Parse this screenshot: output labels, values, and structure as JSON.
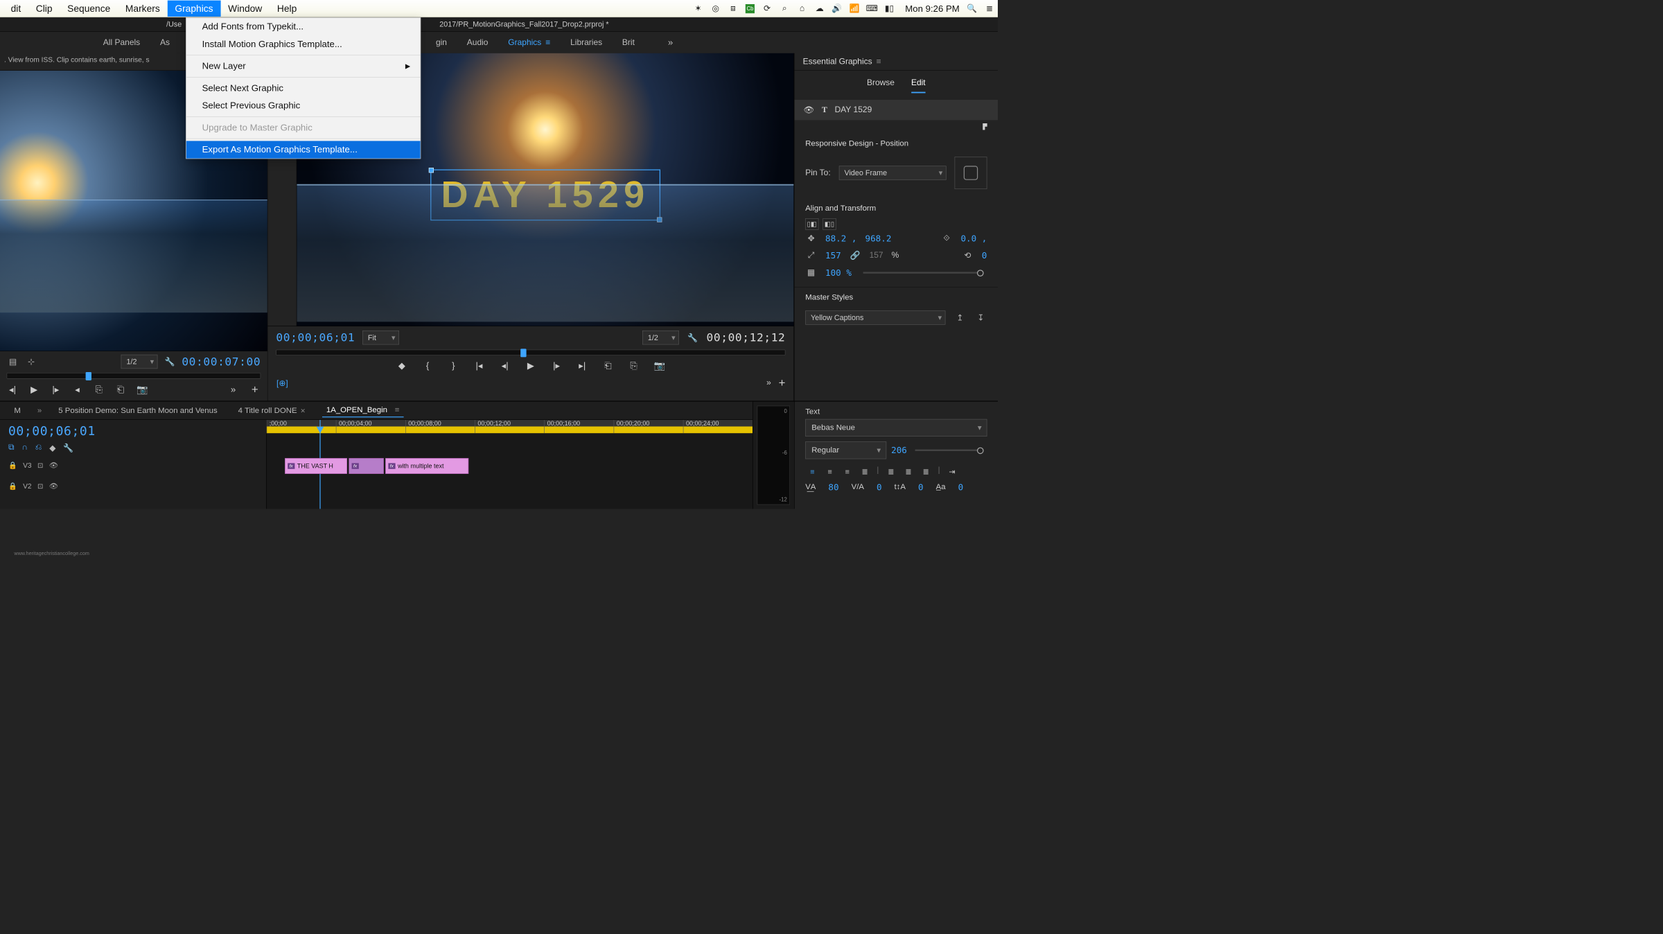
{
  "menubar": {
    "items": [
      "dit",
      "Clip",
      "Sequence",
      "Markers",
      "Graphics",
      "Window",
      "Help"
    ],
    "active_index": 4,
    "clock": "Mon 9:26 PM",
    "sys_icons": [
      "evernote-icon",
      "creative-cloud-icon",
      "dropbox-icon",
      "carbonite-icon",
      "sync-icon",
      "search-sys-icon",
      "home-icon",
      "cloud-upload-icon",
      "volume-icon",
      "wifi-icon",
      "keyboard-icon",
      "battery-icon"
    ]
  },
  "dropdown": {
    "items": [
      {
        "label": "Add Fonts from Typekit..."
      },
      {
        "label": "Install Motion Graphics Template..."
      },
      {
        "sep": true
      },
      {
        "label": "New Layer",
        "submenu": true
      },
      {
        "sep": true
      },
      {
        "label": "Select Next Graphic"
      },
      {
        "label": "Select Previous Graphic"
      },
      {
        "sep": true
      },
      {
        "label": "Upgrade to Master Graphic",
        "disabled": true
      },
      {
        "sep": true
      },
      {
        "label": "Export As Motion Graphics Template...",
        "selected": true
      }
    ]
  },
  "titlebar": {
    "path_left": "/Use",
    "path_right": "2017/PR_MotionGraphics_Fall2017_Drop2.prproj *"
  },
  "workspace": {
    "tabs": [
      "All Panels",
      "As",
      "gin",
      "Audio",
      "Graphics",
      "Libraries",
      "Brit"
    ],
    "active_index": 4
  },
  "source": {
    "info": ". View from ISS. Clip contains earth, sunrise, s",
    "zoom": "1/2",
    "timecode": "00:00:07:00"
  },
  "program": {
    "title_text": "DAY 1529",
    "tc_left": "00;00;06;01",
    "tc_right": "00;00;12;12",
    "fit": "Fit",
    "zoom": "1/2"
  },
  "essential": {
    "title": "Essential Graphics",
    "tabs": [
      "Browse",
      "Edit"
    ],
    "active_tab": 1,
    "layer_name": "DAY 1529",
    "responsive_hdr": "Responsive Design - Position",
    "pin_to_label": "Pin To:",
    "pin_to_value": "Video Frame",
    "align_hdr": "Align and Transform",
    "pos_x": "88.2 ,",
    "pos_y": "968.2",
    "anchor_label": "0.0 ,",
    "scale_w": "157",
    "scale_h": "157",
    "pct": "%",
    "rotation": "0",
    "opacity": "100 %",
    "master_hdr": "Master Styles",
    "master_value": "Yellow Captions",
    "text_hdr": "Text",
    "font": "Bebas Neue",
    "weight": "Regular",
    "size": "206",
    "tracking": "80",
    "kerning": "0",
    "leading": "0",
    "baseline": "0"
  },
  "timeline": {
    "tabs": [
      {
        "label": "M"
      },
      {
        "label": "5 Position Demo: Sun Earth Moon and Venus"
      },
      {
        "label": "4 Title roll DONE",
        "close": true
      },
      {
        "label": "1A_OPEN_Begin",
        "active": true,
        "close": true
      }
    ],
    "tc": "00;00;06;01",
    "ruler": [
      ";00;00",
      "00;00;04;00",
      "00;00;08;00",
      "00;00;12;00",
      "00;00;16;00",
      "00;00;20;00",
      "00;00;24;00"
    ],
    "tracks": [
      "V3",
      "V2"
    ],
    "clip1": "THE VAST H",
    "clip2": "with multiple text",
    "audio_db_top": "0",
    "audio_db_mid": "-6",
    "audio_db_low": "-12"
  },
  "watermark": "www.heritagechristiancollege.com"
}
